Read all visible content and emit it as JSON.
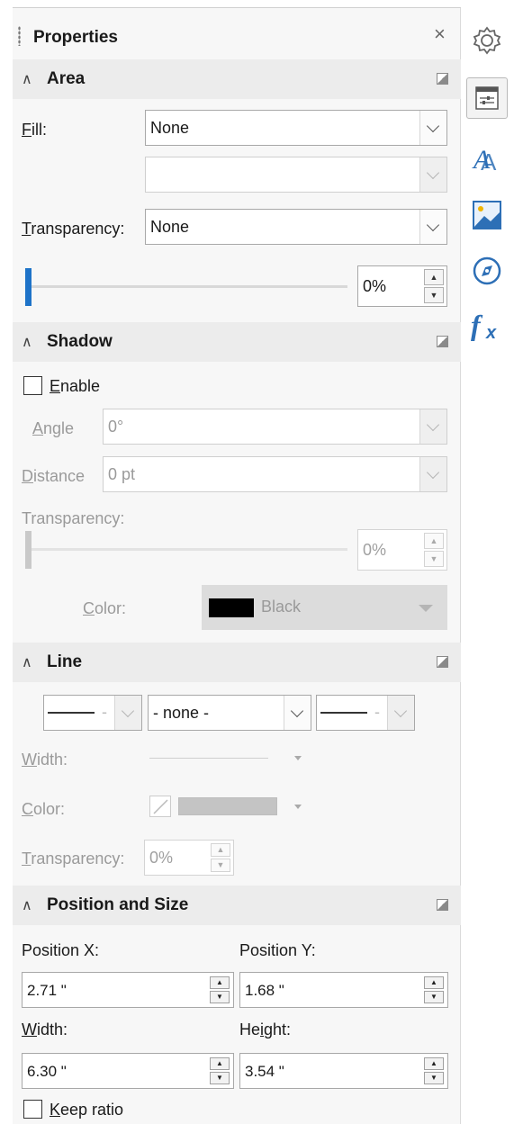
{
  "deck": {
    "title": "Properties",
    "close_glyph": "×"
  },
  "area": {
    "title": "Area",
    "fill_label": "Fill:",
    "fill_value": "None",
    "fill_sub_value": "",
    "transparency_label": "Transparency:",
    "transparency_value": "None",
    "transparency_percent": "0%",
    "slider_level": 0
  },
  "shadow": {
    "title": "Shadow",
    "enable_label": "Enable",
    "enabled": false,
    "angle_label": "Angle",
    "angle_value": "0°",
    "distance_label": "Distance",
    "distance_value": "0 pt",
    "transparency_label": "Transparency:",
    "transparency_percent": "0%",
    "color_label": "Color:",
    "color_value": "Black",
    "color_swatch": "#000000"
  },
  "line": {
    "title": "Line",
    "style_value": "- none -",
    "width_label": "Width:",
    "color_label": "Color:",
    "transparency_label": "Transparency:",
    "transparency_percent": "0%"
  },
  "position_size": {
    "title": "Position and Size",
    "pos_x_label": "Position X:",
    "pos_x_value": "2.71 \"",
    "pos_y_label": "Position Y:",
    "pos_y_value": "1.68 \"",
    "width_label": "Width:",
    "width_value": "6.30 \"",
    "height_label": "Height:",
    "height_value": "3.54 \"",
    "keep_ratio_label": "Keep ratio",
    "keep_ratio": false
  },
  "tabs": [
    {
      "icon": "gear-icon",
      "active": false
    },
    {
      "icon": "properties-icon",
      "active": true
    },
    {
      "icon": "styles-icon",
      "active": false
    },
    {
      "icon": "gallery-icon",
      "active": false
    },
    {
      "icon": "navigator-icon",
      "active": false
    },
    {
      "icon": "functions-icon",
      "active": false
    }
  ],
  "colors": {
    "accent": "#1e73c8",
    "icon_blue": "#2d6fb6"
  }
}
